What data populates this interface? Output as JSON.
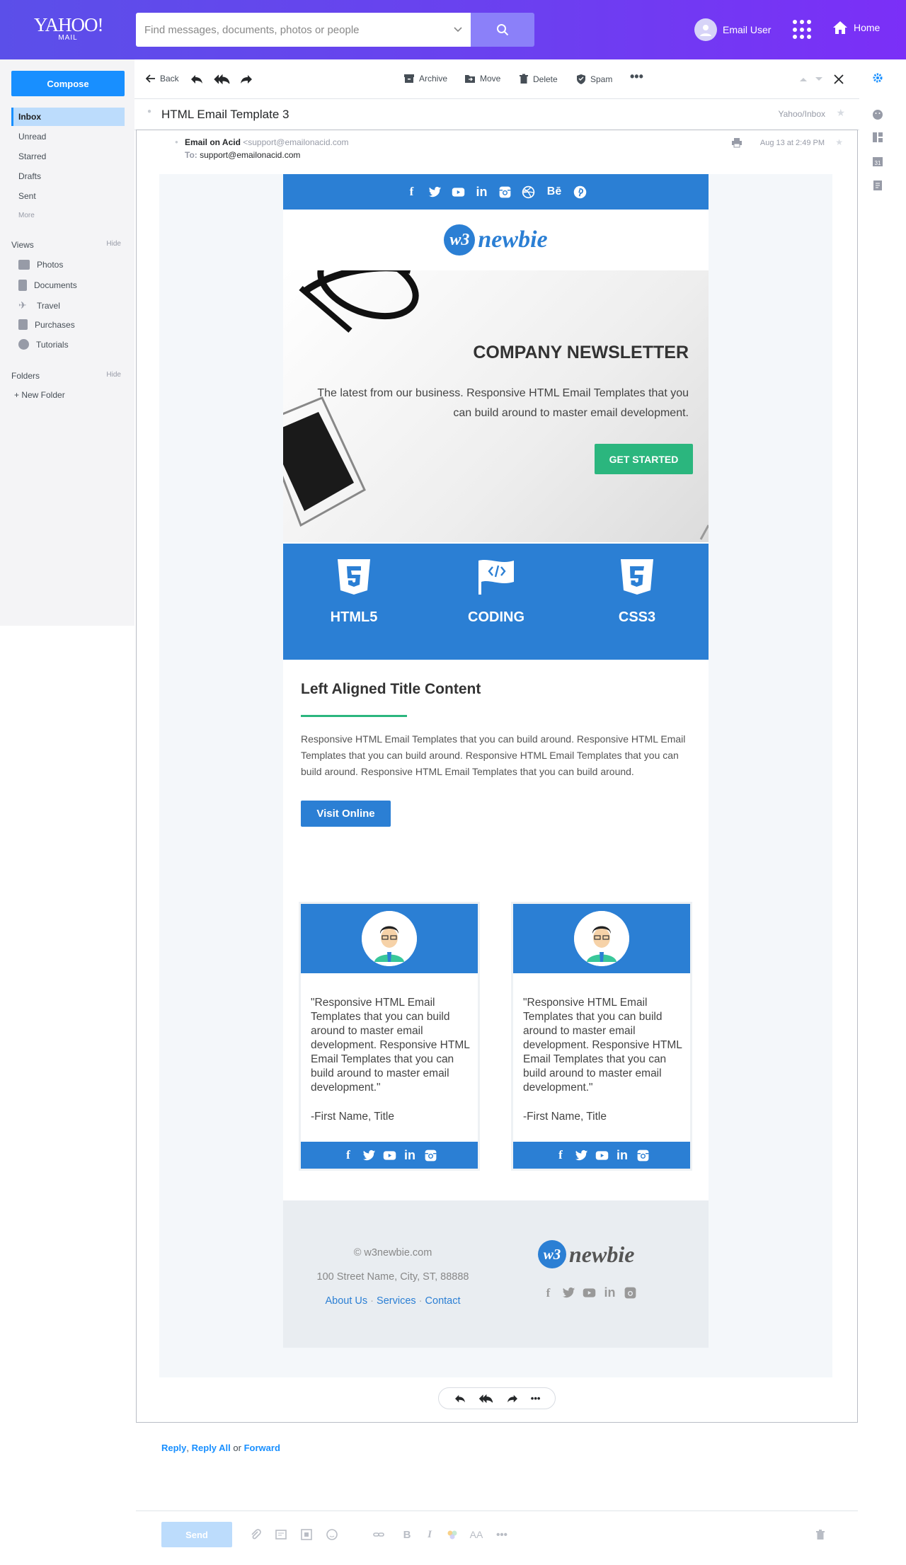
{
  "header": {
    "logo_line1": "YAHOO!",
    "logo_line2": "MAIL",
    "search_placeholder": "Find messages, documents, photos or people",
    "user_name": "Email User",
    "home_label": "Home"
  },
  "sidebar": {
    "compose_label": "Compose",
    "folders": [
      {
        "label": "Inbox",
        "active": true
      },
      {
        "label": "Unread"
      },
      {
        "label": "Starred"
      },
      {
        "label": "Drafts"
      },
      {
        "label": "Sent"
      },
      {
        "label": "More"
      }
    ],
    "views_title": "Views",
    "views_hide": "Hide",
    "views": [
      {
        "label": "Photos",
        "icon": "photos-icon"
      },
      {
        "label": "Documents",
        "icon": "documents-icon"
      },
      {
        "label": "Travel",
        "icon": "travel-icon"
      },
      {
        "label": "Purchases",
        "icon": "purchases-icon"
      },
      {
        "label": "Tutorials",
        "icon": "tutorials-icon"
      }
    ],
    "folders_title": "Folders",
    "folders_hide": "Hide",
    "new_folder": "+ New Folder"
  },
  "toolbar": {
    "back": "Back",
    "archive": "Archive",
    "move": "Move",
    "delete": "Delete",
    "spam": "Spam"
  },
  "message": {
    "subject": "HTML Email Template 3",
    "folder_path": "Yahoo/Inbox",
    "from_name": "Email on Acid",
    "from_email": "<support@emailonacid.com",
    "to_label": "To:",
    "to_email": "support@emailonacid.com",
    "date": "Aug 13 at 2:49 PM"
  },
  "newsletter": {
    "social_top": [
      "f",
      "t",
      "yt",
      "in",
      "ig",
      "dr",
      "Bē",
      "p"
    ],
    "brand_mark": "w3",
    "brand_name": "newbie",
    "hero_title": "COMPANY NEWSLETTER",
    "hero_text": "The latest from our business. Responsive HTML Email Templates that you can build around to master email development.",
    "hero_button": "GET STARTED",
    "skills": [
      "HTML5",
      "CODING",
      "CSS3"
    ],
    "section_title": "Left Aligned Title Content",
    "section_text": "Responsive HTML Email Templates that you can build around. Responsive HTML Email Templates that you can build around. Responsive HTML Email Templates that you can build around. Responsive HTML Email Templates that you can build around.",
    "visit_button": "Visit Online",
    "testimonials": [
      {
        "quote": "\"Responsive HTML Email Templates that you can build around to master email development. Responsive HTML Email Templates that you can build around to master email development.\"",
        "signature": "-First Name, Title"
      },
      {
        "quote": "\"Responsive HTML Email Templates that you can build around to master email development. Responsive HTML Email Templates that you can build around to master email development.\"",
        "signature": "-First Name, Title"
      }
    ],
    "footer_copyright": "© w3newbie.com",
    "footer_address": "100 Street Name, City, ST, 88888",
    "footer_links": [
      "About Us",
      "Services",
      "Contact"
    ],
    "footer_sep": "·"
  },
  "reply": {
    "reply": "Reply",
    "reply_all": "Reply All",
    "or": "or",
    "forward": "Forward",
    "send": "Send"
  },
  "colors": {
    "header_start": "#5b4fe9",
    "header_end": "#7b2ff7",
    "brand_blue": "#2b7fd4",
    "accent_green": "#2bb67e",
    "compose_blue": "#188fff"
  }
}
